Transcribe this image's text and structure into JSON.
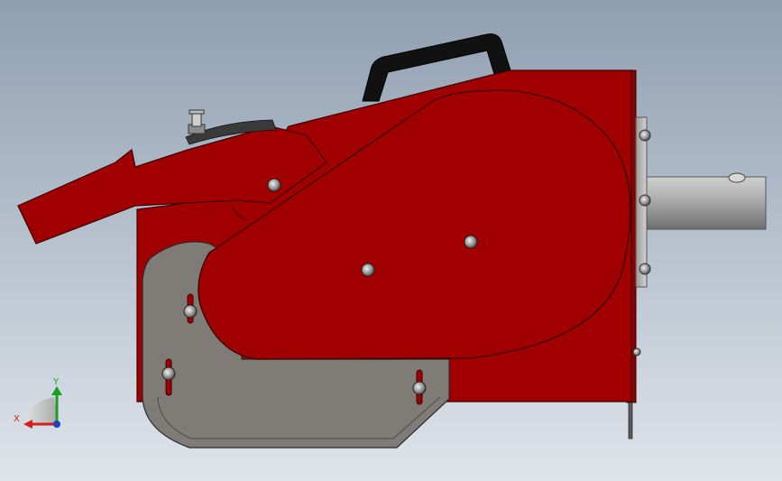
{
  "viewport": {
    "background_top": "#8f9fb1",
    "background_bottom": "#dfe4ea"
  },
  "model": {
    "body_color": "#a00000",
    "body_edge": "#3a0000",
    "guard_color": "#7f7c78",
    "handle_color": "#111111",
    "shaft_color": "#9d9d9d",
    "flange_color": "#b8b8b8"
  },
  "triad": {
    "x_label": "X",
    "y_label": "Y",
    "x_color": "#d11f1f",
    "y_color": "#16a21e",
    "z_color": "#1f3fbf"
  }
}
